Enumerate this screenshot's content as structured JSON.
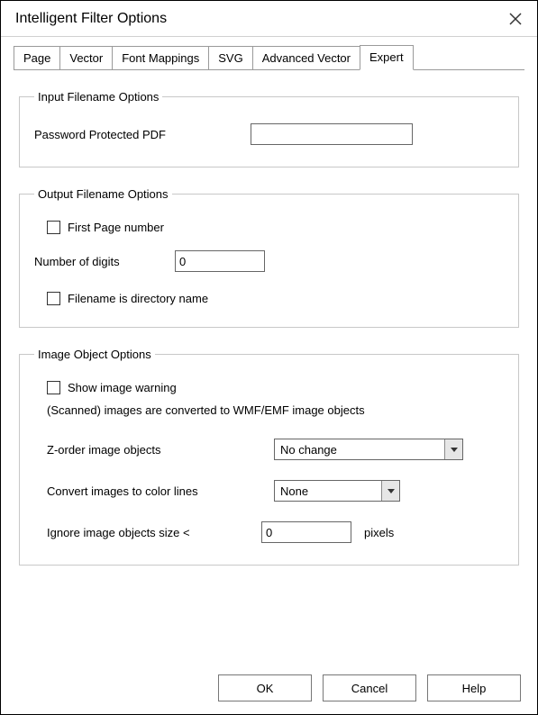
{
  "title": "Intelligent Filter Options",
  "tabs": {
    "page": "Page",
    "vector": "Vector",
    "font_mappings": "Font Mappings",
    "svg": "SVG",
    "advanced_vector": "Advanced Vector",
    "expert": "Expert"
  },
  "group_input": {
    "legend": "Input Filename Options",
    "password_label": "Password Protected PDF",
    "password_value": ""
  },
  "group_output": {
    "legend": "Output Filename Options",
    "first_page_label": "First Page number",
    "digits_label": "Number of digits",
    "digits_value": "0",
    "filename_dir_label": "Filename is directory name"
  },
  "group_image": {
    "legend": "Image Object Options",
    "show_warning_label": "Show image warning",
    "scanned_note": "(Scanned) images are converted to WMF/EMF image objects",
    "zorder_label": "Z-order image objects",
    "zorder_value": "No change",
    "convert_label": "Convert images to color lines",
    "convert_value": "None",
    "ignore_label": "Ignore image objects size <",
    "ignore_value": "0",
    "ignore_unit": "pixels"
  },
  "buttons": {
    "ok": "OK",
    "cancel": "Cancel",
    "help": "Help"
  }
}
